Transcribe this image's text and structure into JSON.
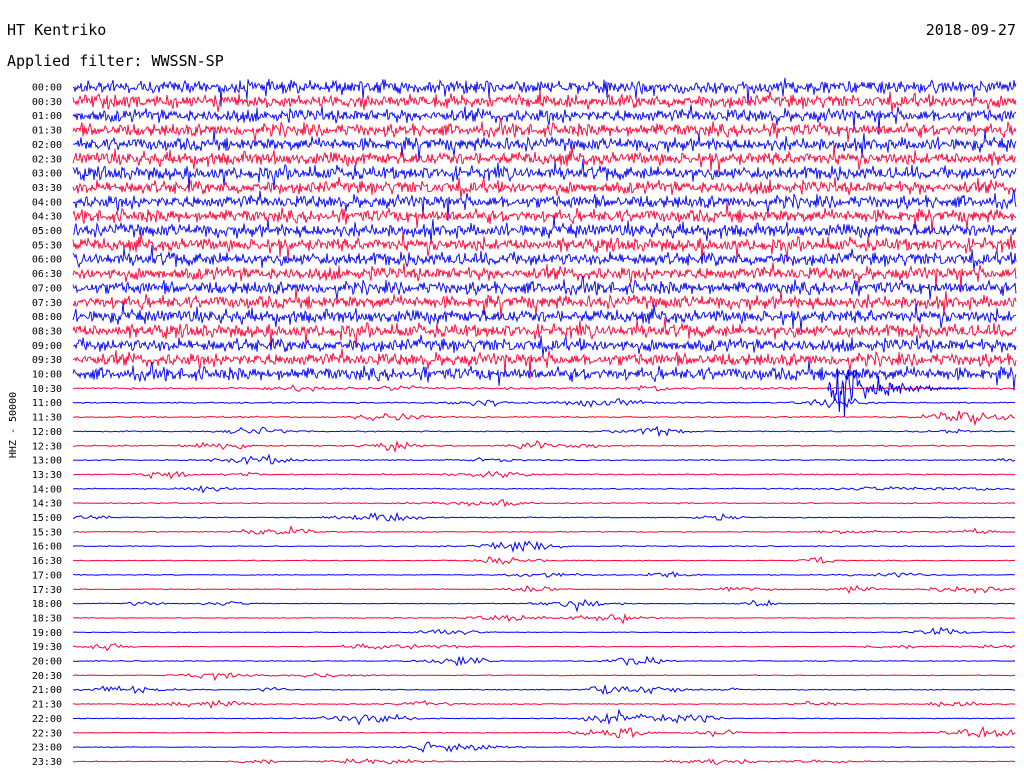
{
  "header": {
    "station": "HT Kentriko",
    "date": "2018-09-27",
    "filter": "Applied filter: WWSSN-SP"
  },
  "chart_data": {
    "type": "line",
    "title": "HT Kentriko",
    "subtitle": "Applied filter: WWSSN-SP",
    "date": "2018-09-27",
    "ylabel": "HHZ - 50000",
    "xlabel": "",
    "tick_labels": [
      "00:00",
      "00:30",
      "01:00",
      "01:30",
      "02:00",
      "02:30",
      "03:00",
      "03:30",
      "04:00",
      "04:30",
      "05:00",
      "05:30",
      "06:00",
      "06:30",
      "07:00",
      "07:30",
      "08:00",
      "08:30",
      "09:00",
      "09:30",
      "10:00",
      "10:30",
      "11:00",
      "11:30",
      "12:00",
      "12:30",
      "13:00",
      "13:30",
      "14:00",
      "14:30",
      "15:00",
      "15:30",
      "16:00",
      "16:30",
      "17:00",
      "17:30",
      "18:00",
      "18:30",
      "19:00",
      "19:30",
      "20:00",
      "20:30",
      "21:00",
      "21:30",
      "22:00",
      "22:30",
      "23:00",
      "23:30"
    ],
    "line_duration_minutes": 30,
    "series_colors": [
      "#0000ff",
      "#ff0033"
    ],
    "grid": false,
    "legend": "none",
    "traces_noise_level": [
      9,
      9,
      9,
      9,
      9,
      9,
      9,
      9,
      9,
      9,
      9,
      9,
      9,
      9,
      9,
      9,
      9,
      9,
      9,
      9,
      9,
      1.4,
      0.9,
      1.0,
      0.8,
      0.8,
      0.8,
      0.9,
      0.8,
      0.7,
      0.7,
      0.7,
      0.7,
      0.6,
      0.6,
      0.6,
      0.5,
      0.5,
      0.5,
      0.5,
      0.6,
      0.6,
      0.7,
      0.7,
      0.6,
      0.5,
      0.5,
      0.5
    ],
    "events": [
      {
        "time": "10:30",
        "minute": 24,
        "amplitude": 10,
        "note": "large event"
      }
    ]
  }
}
